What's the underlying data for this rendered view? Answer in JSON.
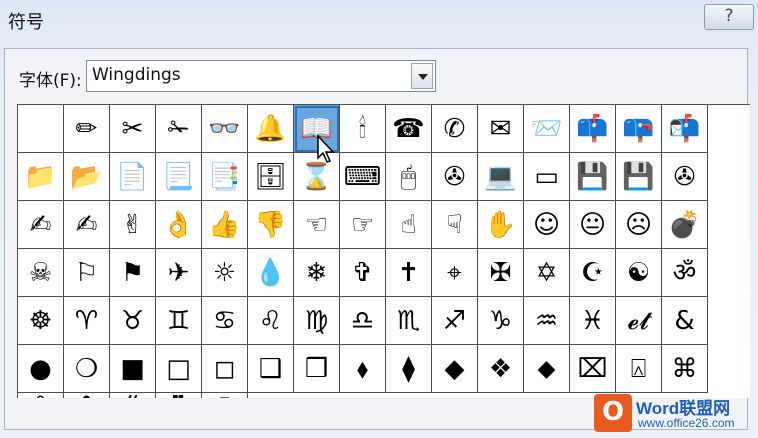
{
  "dialog": {
    "title": "符号",
    "help_label": "?",
    "font_label": "字体(F):",
    "font_value": "Wingdings"
  },
  "symbols": [
    [
      "",
      "✏",
      "✂",
      "✁",
      "👓",
      "🔔",
      "📖",
      "🕯",
      "☎",
      "✆",
      "✉",
      "📨",
      "📫",
      "📪",
      "📬"
    ],
    [
      "📁",
      "📂",
      "📄",
      "📃",
      "📑",
      "🗄",
      "⌛",
      "⌨",
      "🖱",
      "✇",
      "💻",
      "▭",
      "💾",
      "💾",
      "✇",
      "✍"
    ],
    [
      "✍",
      "✌",
      "👌",
      "👍",
      "👎",
      "☜",
      "☞",
      "☝",
      "☟",
      "✋",
      "☺",
      "😐",
      "☹",
      "💣",
      "☠",
      "⚐"
    ],
    [
      "⚑",
      "✈",
      "☼",
      "💧",
      "❄",
      "✞",
      "✝",
      "⌖",
      "✠",
      "✡",
      "☪",
      "☯",
      "ॐ",
      "☸",
      "♈",
      "♉"
    ],
    [
      "♊",
      "♋",
      "♌",
      "♍",
      "♎",
      "♏",
      "♐",
      "♑",
      "♒",
      "♓",
      "𝓮𝓽",
      "&",
      "●",
      "❍",
      "■",
      "□"
    ],
    [
      "◻",
      "❑",
      "❒",
      "⬧",
      "⧫",
      "◆",
      "❖",
      "⬥",
      "⌧",
      "⍓",
      "⌘",
      "❀",
      "✿",
      "❝",
      "❞",
      "▯"
    ]
  ],
  "selected": {
    "row": 0,
    "col": 6
  },
  "watermark": {
    "line1": "Word联盟网",
    "line2": "www.office26.com",
    "logo": "O"
  }
}
